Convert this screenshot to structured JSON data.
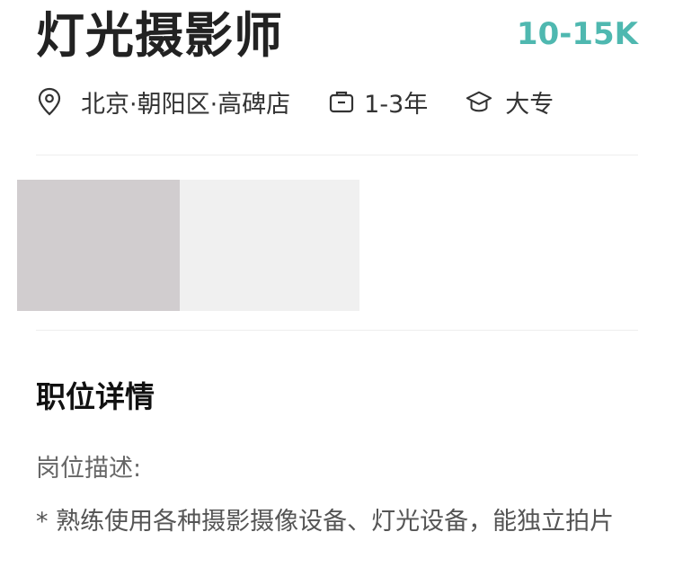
{
  "job": {
    "title": "灯光摄影师",
    "salary": "10-15K",
    "location": "北京·朝阳区·高碑店",
    "experience": "1-3年",
    "education": "大专"
  },
  "icons": {
    "location": "location-pin-icon",
    "experience": "briefcase-icon",
    "education": "graduation-cap-icon"
  },
  "colors": {
    "accent": "#4fb8b0"
  },
  "details": {
    "section_title": "职位详情",
    "description_label": "岗位描述:",
    "description_text": "* 熟练使用各种摄影摄像设备、灯光设备，能独立拍片"
  }
}
